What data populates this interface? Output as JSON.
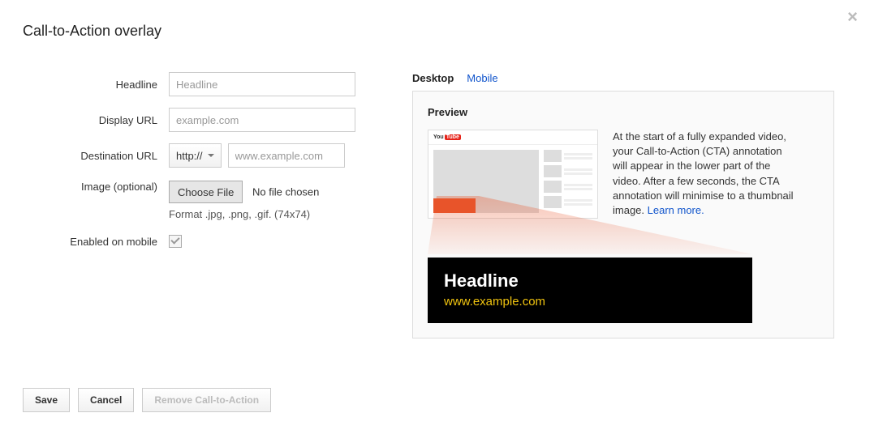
{
  "title": "Call-to-Action overlay",
  "close_glyph": "×",
  "form": {
    "headline": {
      "label": "Headline",
      "placeholder": "Headline",
      "value": ""
    },
    "display_url": {
      "label": "Display URL",
      "placeholder": "example.com",
      "value": ""
    },
    "destination_url": {
      "label": "Destination URL",
      "protocol": "http://",
      "placeholder": "www.example.com",
      "value": ""
    },
    "image": {
      "label": "Image (optional)",
      "choose_label": "Choose File",
      "status": "No file chosen",
      "hint": "Format .jpg, .png, .gif. (74x74)"
    },
    "mobile": {
      "label": "Enabled on mobile",
      "checked": true
    }
  },
  "tabs": {
    "desktop": "Desktop",
    "mobile": "Mobile"
  },
  "preview": {
    "title": "Preview",
    "description": "At the start of a fully expanded video, your Call-to-Action (CTA) annotation will appear in the lower part of the video. After a few seconds, the CTA annotation will minimise to a thumbnail image. ",
    "learn_more": "Learn more.",
    "cta_headline": "Headline",
    "cta_url": "www.example.com"
  },
  "actions": {
    "save": "Save",
    "cancel": "Cancel",
    "remove": "Remove Call-to-Action"
  }
}
